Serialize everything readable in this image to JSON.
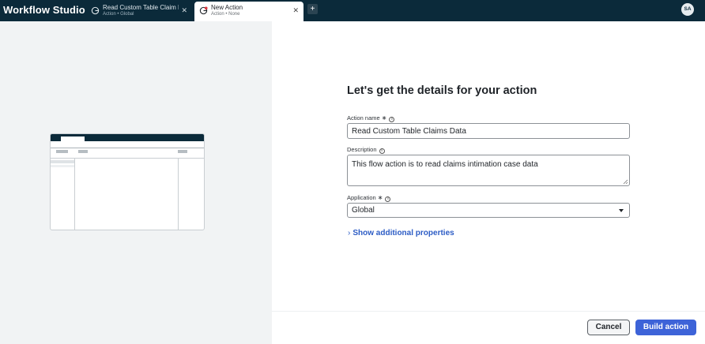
{
  "app": {
    "title": "Workflow Studio"
  },
  "tabs": [
    {
      "title": "Read Custom Table Claim D",
      "subtitle": "Action • Global",
      "active": false
    },
    {
      "title": "New Action",
      "subtitle": "Action • None",
      "active": true
    }
  ],
  "header": {
    "new_tab_label": "+",
    "avatar_initials": "SA"
  },
  "form": {
    "title": "Let's get the details for your action",
    "action_name": {
      "label": "Action name",
      "value": "Read Custom Table Claims Data"
    },
    "description": {
      "label": "Description",
      "value": "This flow action is to read claims intimation case data"
    },
    "application": {
      "label": "Application",
      "value": "Global"
    },
    "required_mark": "∗",
    "info_mark": "i",
    "show_more_label": "Show additional properties"
  },
  "footer": {
    "cancel_label": "Cancel",
    "build_label": "Build action"
  },
  "colors": {
    "topbar": "#0b2a3a",
    "primary": "#3d63d8",
    "link": "#2c5cc5",
    "tab_icon_accent": "#d9363e"
  }
}
